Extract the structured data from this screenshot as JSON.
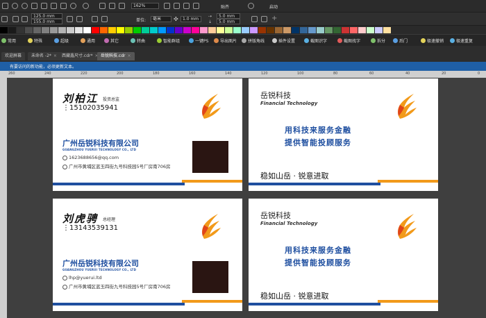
{
  "toolbar": {
    "width_value": "125.0 mm",
    "height_value": "155.0 mm",
    "zoom": "162%",
    "unit_label": "单位:",
    "unit_value": "毫米",
    "nudge_value": "1.0 mm",
    "dup_x": "5.0 mm",
    "dup_y": "5.0 mm",
    "snap_label": "贴齐",
    "launch_label": "启动"
  },
  "palette": [
    "#000000",
    "#1a1a1a",
    "#333333",
    "#4d4d4d",
    "#666666",
    "#808080",
    "#999999",
    "#b3b3b3",
    "#cccccc",
    "#e6e6e6",
    "#ffffff",
    "#ff0000",
    "#ff6600",
    "#ffcc00",
    "#ffff00",
    "#99cc00",
    "#00cc00",
    "#00cc99",
    "#00cccc",
    "#0099ff",
    "#0033cc",
    "#6600cc",
    "#cc00cc",
    "#ff0099",
    "#ff99cc",
    "#ffcc99",
    "#ffff99",
    "#ccff99",
    "#99ffcc",
    "#99ccff",
    "#cc99ff",
    "#993300",
    "#663300",
    "#996633",
    "#cc9966",
    "#003366",
    "#336699",
    "#6699cc",
    "#99cccc",
    "#669966",
    "#336633",
    "#cc3333",
    "#ff6666",
    "#ffcccc",
    "#ccffcc",
    "#ccccff",
    "#ffe0a0"
  ],
  "plugins": [
    {
      "label": "常用",
      "icon_color": "#7fc16b"
    },
    {
      "label": "特殊",
      "icon_color": "#e3d35a"
    },
    {
      "label": "超级",
      "icon_color": "#5a9fe3"
    },
    {
      "label": "通用",
      "icon_color": "#e3a15a"
    },
    {
      "label": "其它",
      "icon_color": "#c16bb0"
    },
    {
      "label": "转曲",
      "icon_color": "#6bc1b5"
    },
    {
      "label": "智能群组",
      "icon_color": "#9acd32"
    },
    {
      "label": "一键PS",
      "icon_color": "#4aa3df"
    },
    {
      "label": "导出图片",
      "icon_color": "#df8a4a"
    },
    {
      "label": "拼版角线",
      "icon_color": "#aaaaaa"
    },
    {
      "label": "插件设置",
      "icon_color": "#cccccc"
    },
    {
      "label": "截图识字",
      "icon_color": "#5ab0e3"
    },
    {
      "label": "截图找字",
      "icon_color": "#e35a5a"
    },
    {
      "label": "拆分",
      "icon_color": "#7fc16b"
    },
    {
      "label": "后门",
      "icon_color": "#5a9fe3"
    },
    {
      "label": "极速撤销",
      "icon_color": "#e3d35a"
    },
    {
      "label": "极速重复",
      "icon_color": "#5ab0e3"
    }
  ],
  "tabs": [
    {
      "label": "欢迎屏幕",
      "active": false
    },
    {
      "label": "未命名 -2*",
      "active": false
    },
    {
      "label": "西藏鑫尺寸.cdr*",
      "active": false
    },
    {
      "label": "岳锐科技.cdr",
      "active": true
    }
  ],
  "info_text": "有要访问的新功能，必须更新文本。",
  "ruler_ticks": [
    "260",
    "240",
    "220",
    "200",
    "180",
    "160",
    "140",
    "120",
    "100",
    "80",
    "60",
    "40",
    "20",
    "0"
  ],
  "colors": {
    "brand_blue": "#1f4fa0",
    "accent_orange": "#f29a1a",
    "infobar": "#1f5fa6",
    "qr_dark": "#2a1512"
  },
  "card_front_1": {
    "name": "刘柏江",
    "role": "投资总监",
    "phone": "15102035941",
    "company": "广州岳锐科技有限公司",
    "company_en": "GUANGZHOU YUERUI TECHNOLOGY CO., LTD",
    "email": "1623688656@qq.com",
    "address": "广州市黄埔区蓝玉四街九号科技园5号厂房南706房"
  },
  "card_front_2": {
    "name": "刘虎骋",
    "role": "总经理",
    "phone": "13143539131",
    "company": "广州岳锐科技有限公司",
    "company_en": "GUANGZHOU YUERUI TECHNOLOGY CO., LTD",
    "email": "lhp@yuerui.ltd",
    "address": "广州市黄埔区蓝玉四街九号科技园5号厂房南706房"
  },
  "card_back": {
    "brand": "岳锐科技",
    "brand_en": "Financial Technology",
    "slogan_1": "用科技来服务金融",
    "slogan_2": "提供智能投顾服务",
    "motto": "稳如山岳 · 锐意进取"
  }
}
